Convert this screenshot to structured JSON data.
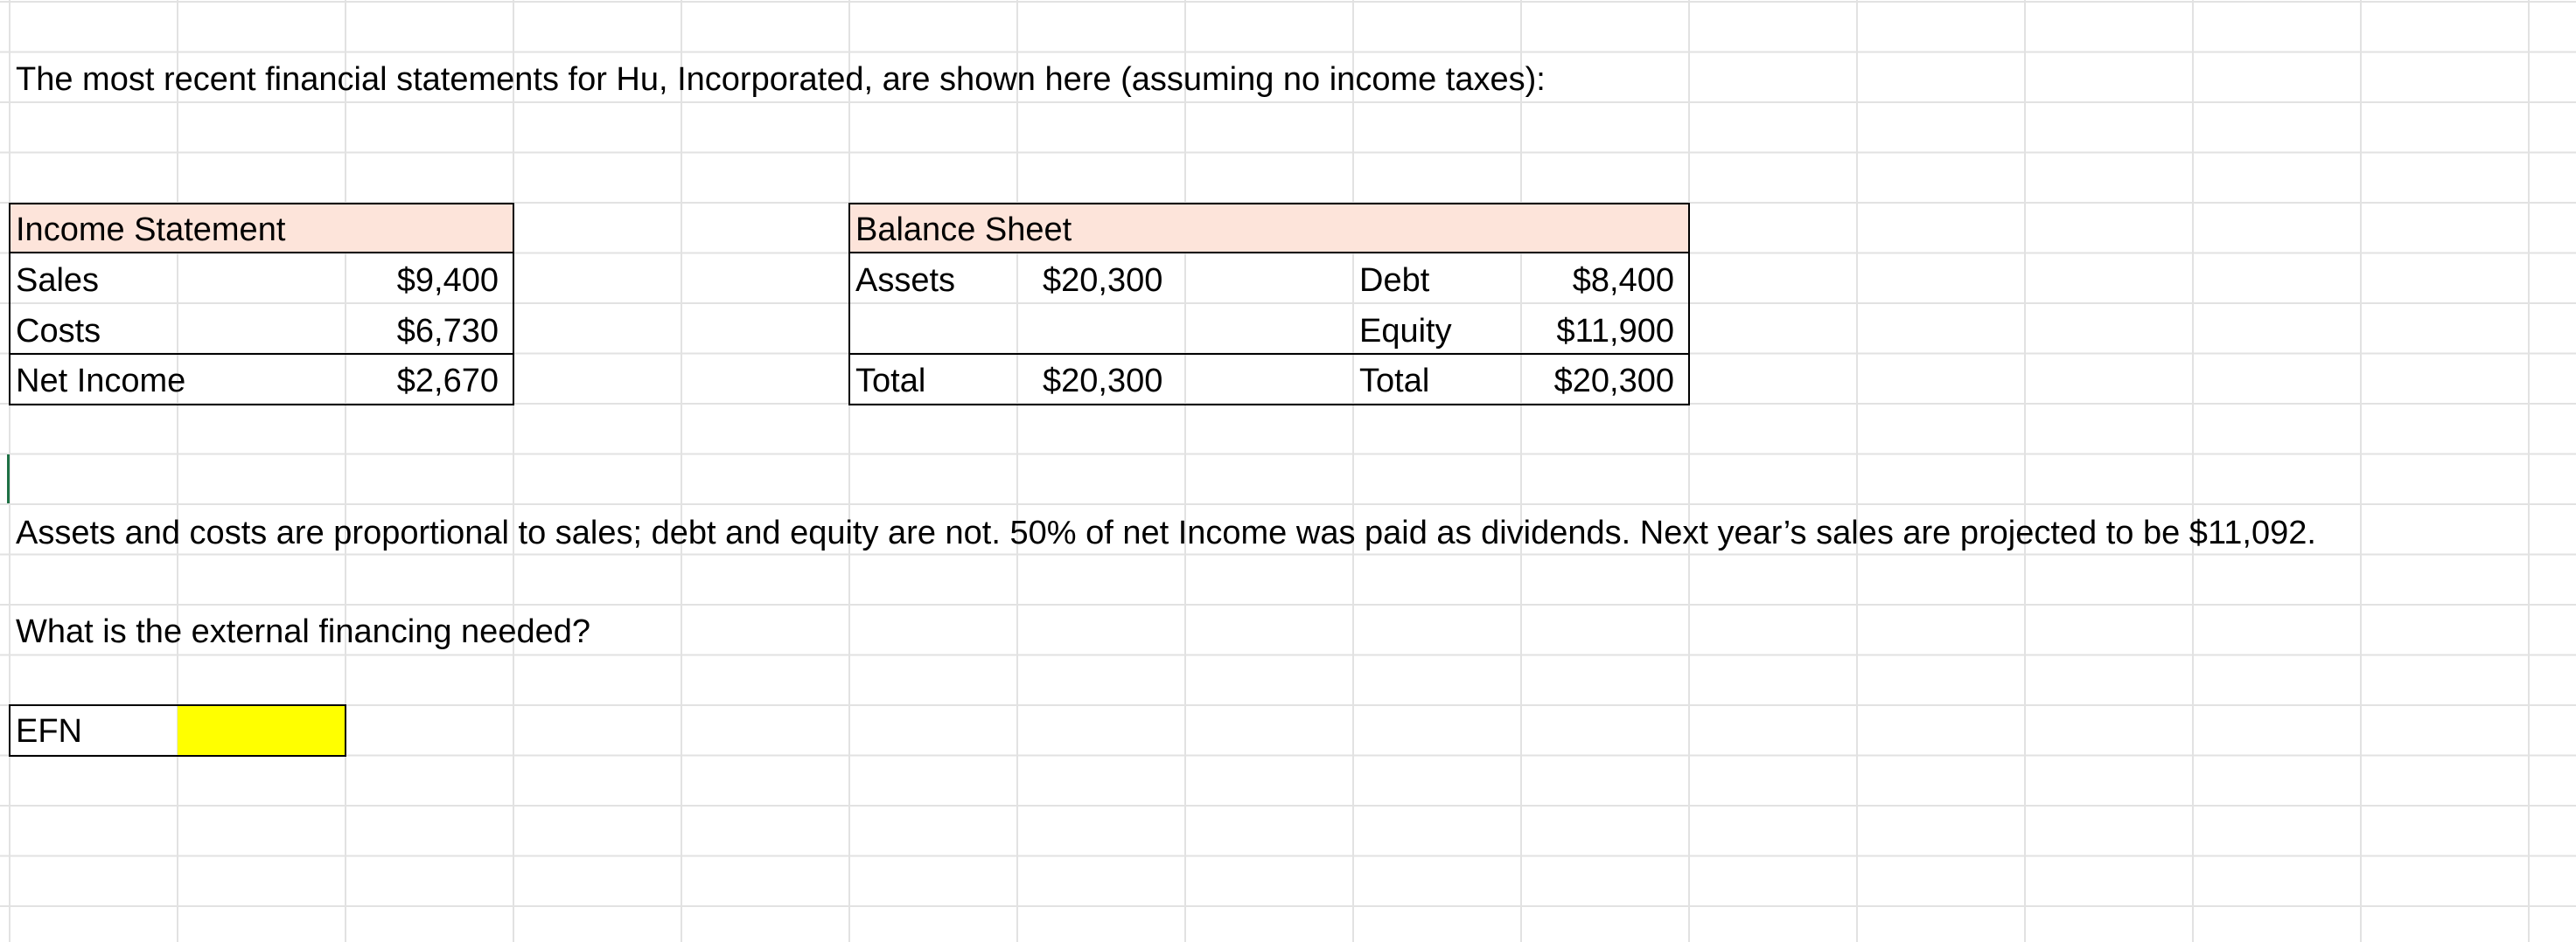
{
  "intro_text": "The most recent financial statements for Hu, Incorporated, are shown here (assuming no income taxes):",
  "income_statement": {
    "title": "Income Statement",
    "rows": [
      {
        "label": "Sales",
        "value": "$9,400"
      },
      {
        "label": "Costs",
        "value": "$6,730"
      },
      {
        "label": "Net Income",
        "value": "$2,670"
      }
    ]
  },
  "balance_sheet": {
    "title": "Balance Sheet",
    "assets_label": "Assets",
    "assets_value": "$20,300",
    "total_left_label": "Total",
    "total_left_value": "$20,300",
    "debt_label": "Debt",
    "debt_value": "$8,400",
    "equity_label": "Equity",
    "equity_value": "$11,900",
    "total_right_label": "Total",
    "total_right_value": "$20,300"
  },
  "assumptions_text": "Assets and costs are proportional to sales; debt and equity are not.  50% of net Income was paid as dividends. Next year’s sales are projected to be $11,092.",
  "question_text": "What is the external financing needed?",
  "efn": {
    "label": "EFN",
    "answer_value": "",
    "answer_color": "#ffff00"
  }
}
